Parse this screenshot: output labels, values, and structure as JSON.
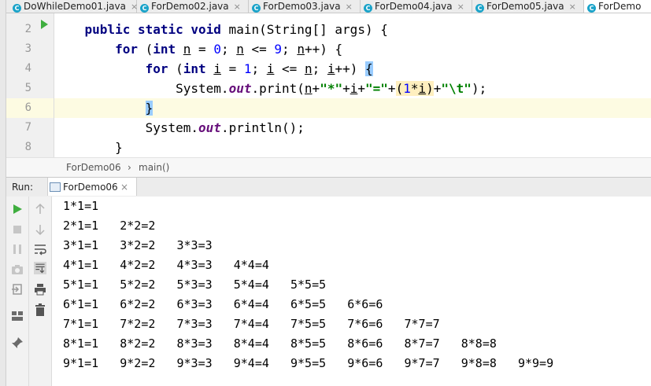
{
  "tabs": [
    {
      "label": "DoWhileDemo01.java",
      "active": false
    },
    {
      "label": "ForDemo02.java",
      "active": false
    },
    {
      "label": "ForDemo03.java",
      "active": false
    },
    {
      "label": "ForDemo04.java",
      "active": false
    },
    {
      "label": "ForDemo05.java",
      "active": false
    },
    {
      "label": "ForDemo",
      "active": true
    }
  ],
  "editor": {
    "line_numbers": [
      "2",
      "3",
      "4",
      "5",
      "6",
      "7",
      "8"
    ]
  },
  "breadcrumb": {
    "file": "ForDemo06",
    "separator": "›",
    "method": "main()"
  },
  "run": {
    "label": "Run:",
    "config": "ForDemo06"
  },
  "console": {
    "lines": [
      "1*1=1",
      "2*1=1   2*2=2",
      "3*1=1   3*2=2   3*3=3",
      "4*1=1   4*2=2   4*3=3   4*4=4",
      "5*1=1   5*2=2   5*3=3   5*4=4   5*5=5",
      "6*1=1   6*2=2   6*3=3   6*4=4   6*5=5   6*6=6",
      "7*1=1   7*2=2   7*3=3   7*4=4   7*5=5   7*6=6   7*7=7",
      "8*1=1   8*2=2   8*3=3   8*4=4   8*5=5   8*6=6   8*7=7   8*8=8",
      "9*1=1   9*2=2   9*3=3   9*4=4   9*5=5   9*6=6   9*7=7   9*8=8   9*9=9"
    ]
  },
  "colors": {
    "keyword": "#000080",
    "number": "#0000ff",
    "string": "#008000",
    "field": "#660e7a",
    "run_green": "#3fae3f"
  },
  "icons": [
    "java-class-icon",
    "run-arrow-icon",
    "rerun-icon",
    "stop-icon",
    "pause-icon",
    "camera-icon",
    "exit-icon",
    "layout-icon",
    "pin-icon",
    "scroll-up-icon",
    "scroll-down-icon",
    "soft-wrap-icon",
    "scroll-to-end-icon",
    "print-icon",
    "trash-icon"
  ]
}
